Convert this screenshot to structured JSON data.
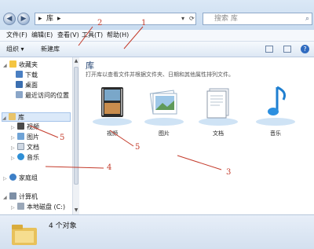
{
  "address": {
    "segments": [
      "▸",
      "库",
      "▸"
    ],
    "search_placeholder": "搜索 库"
  },
  "menu": [
    "文件(F)",
    "编辑(E)",
    "查看(V)",
    "工具(T)",
    "帮助(H)"
  ],
  "toolbar": {
    "organize_label": "组织 ▾",
    "new_library_label": "新建库"
  },
  "nav": {
    "favorites": {
      "label": "收藏夹",
      "items": [
        "下载",
        "桌面",
        "最近访问的位置"
      ]
    },
    "libraries": {
      "label": "库",
      "items": [
        "视频",
        "图片",
        "文档",
        "音乐"
      ]
    },
    "homegroup": "家庭组",
    "computer": {
      "label": "计算机",
      "items": [
        "本地磁盘 (C:)"
      ]
    }
  },
  "content": {
    "title": "库",
    "description": "打开库以查看文件并根据文件夹、日期和其他属性排列文件。",
    "libraries": [
      {
        "name": "视频",
        "icon": "video-library-icon"
      },
      {
        "name": "图片",
        "icon": "pictures-library-icon"
      },
      {
        "name": "文档",
        "icon": "documents-library-icon"
      },
      {
        "name": "音乐",
        "icon": "music-library-icon"
      }
    ]
  },
  "details": {
    "count": "4 个对象"
  },
  "annotations": [
    "1",
    "2",
    "3",
    "4",
    "5",
    "5"
  ],
  "colors": {
    "annotation": "#c43b2b",
    "accent": "#1e3f6e",
    "selection": "#dbe9f9"
  }
}
